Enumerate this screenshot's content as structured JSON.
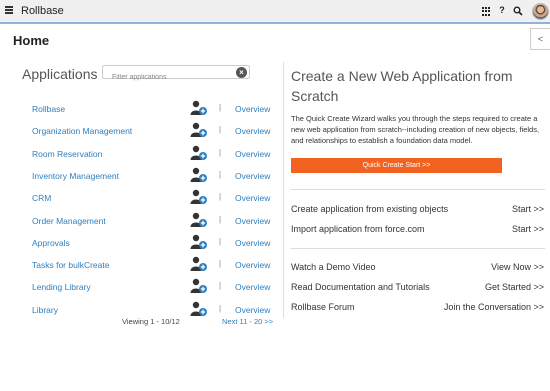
{
  "header": {
    "brand": "Rollbase",
    "icons": [
      "hamburger-icon",
      "app-grid-icon",
      "help-icon",
      "search-icon",
      "avatar"
    ],
    "help_label": "?"
  },
  "page": {
    "title": "Home",
    "collapse_label": "<"
  },
  "applications": {
    "heading": "Applications",
    "filter_placeholder": "Filter applications",
    "clear_symbol": "×",
    "separator": "|",
    "items": [
      {
        "name": "Rollbase",
        "overview": "Overview"
      },
      {
        "name": "Organization Management",
        "overview": "Overview"
      },
      {
        "name": "Room Reservation",
        "overview": "Overview"
      },
      {
        "name": "Inventory Management",
        "overview": "Overview"
      },
      {
        "name": "CRM",
        "overview": "Overview"
      },
      {
        "name": "Order Management",
        "overview": "Overview"
      },
      {
        "name": "Approvals",
        "overview": "Overview"
      },
      {
        "name": "Tasks for bulkCreate",
        "overview": "Overview"
      },
      {
        "name": "Lending Library",
        "overview": "Overview"
      },
      {
        "name": "Library",
        "overview": "Overview"
      }
    ],
    "pagination": {
      "viewing": "Viewing 1 - 10/12",
      "next": "Next 11 - 20 >>"
    }
  },
  "wizard": {
    "title": "Create a New Web Application from Scratch",
    "description": "The Quick Create Wizard walks you through the steps required to create a new web application from scratch--including creation of new objects, fields, and relationships to establish a foundation data model.",
    "button": "Quick Create Start >>",
    "button_color": "#f26322"
  },
  "actions": {
    "existing_label": "Create application from existing objects",
    "existing_link": "Start >>",
    "import_label": "Import application from force.com",
    "import_link": "Start >>",
    "demo_label": "Watch a Demo Video",
    "demo_link": "View Now >>",
    "docs_label": "Read Documentation and Tutorials",
    "docs_link": "Get Started >>",
    "forum_label": "Rollbase Forum",
    "forum_link": "Join the Conversation >>"
  },
  "colors": {
    "link": "#2f7fbf",
    "accent": "#f26322"
  }
}
